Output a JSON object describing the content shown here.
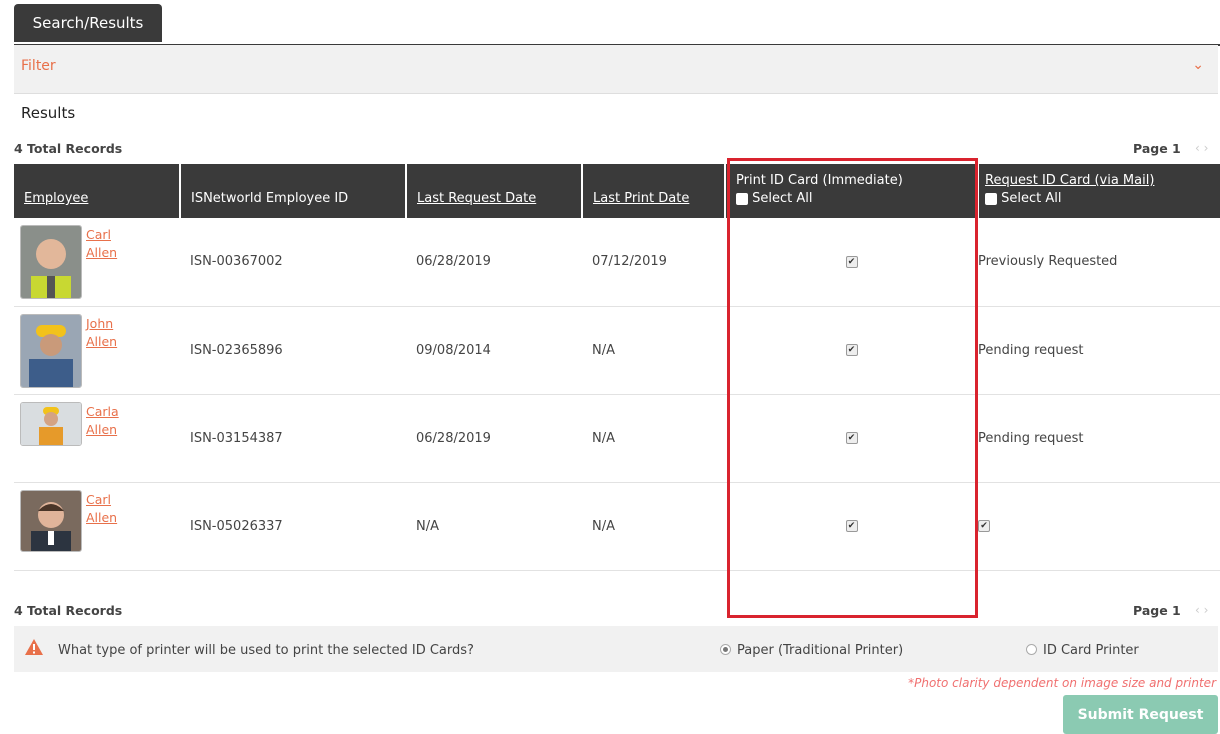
{
  "tabs": [
    {
      "label": "Search/Results"
    }
  ],
  "filter": {
    "label": "Filter"
  },
  "results": {
    "title": "Results",
    "total_records": "4 Total Records",
    "page_label": "Page 1",
    "columns": {
      "employee": "Employee",
      "isn_id": "ISNetworld Employee ID",
      "last_request": "Last Request Date",
      "last_print": "Last Print Date",
      "print_card": "Print ID Card (Immediate)",
      "request_card": "Request ID Card (via Mail)",
      "select_all": "Select All"
    },
    "rows": [
      {
        "first": "Carl",
        "last": "Allen",
        "isn_id": "ISN-00367002",
        "last_request": "06/28/2019",
        "last_print": "07/12/2019",
        "request_status": "Previously Requested"
      },
      {
        "first": "John",
        "last": "Allen",
        "isn_id": "ISN-02365896",
        "last_request": "09/08/2014",
        "last_print": "N/A",
        "request_status": "Pending request"
      },
      {
        "first": "Carla",
        "last": "Allen",
        "isn_id": "ISN-03154387",
        "last_request": "06/28/2019",
        "last_print": "N/A",
        "request_status": "Pending request"
      },
      {
        "first": "Carl",
        "last": "Allen",
        "isn_id": "ISN-05026337",
        "last_request": "N/A",
        "last_print": "N/A",
        "request_status": ""
      }
    ]
  },
  "printer": {
    "question": "What type of printer will be used to print the selected ID Cards?",
    "option_paper": "Paper (Traditional Printer)",
    "option_id": "ID Card Printer"
  },
  "note": "*Photo clarity dependent on image size and printer",
  "submit_label": "Submit Request",
  "colors": {
    "accent": "#e8704a",
    "header": "#3a3a3a",
    "submit": "#8bcab2",
    "highlight": "#d9232e"
  }
}
